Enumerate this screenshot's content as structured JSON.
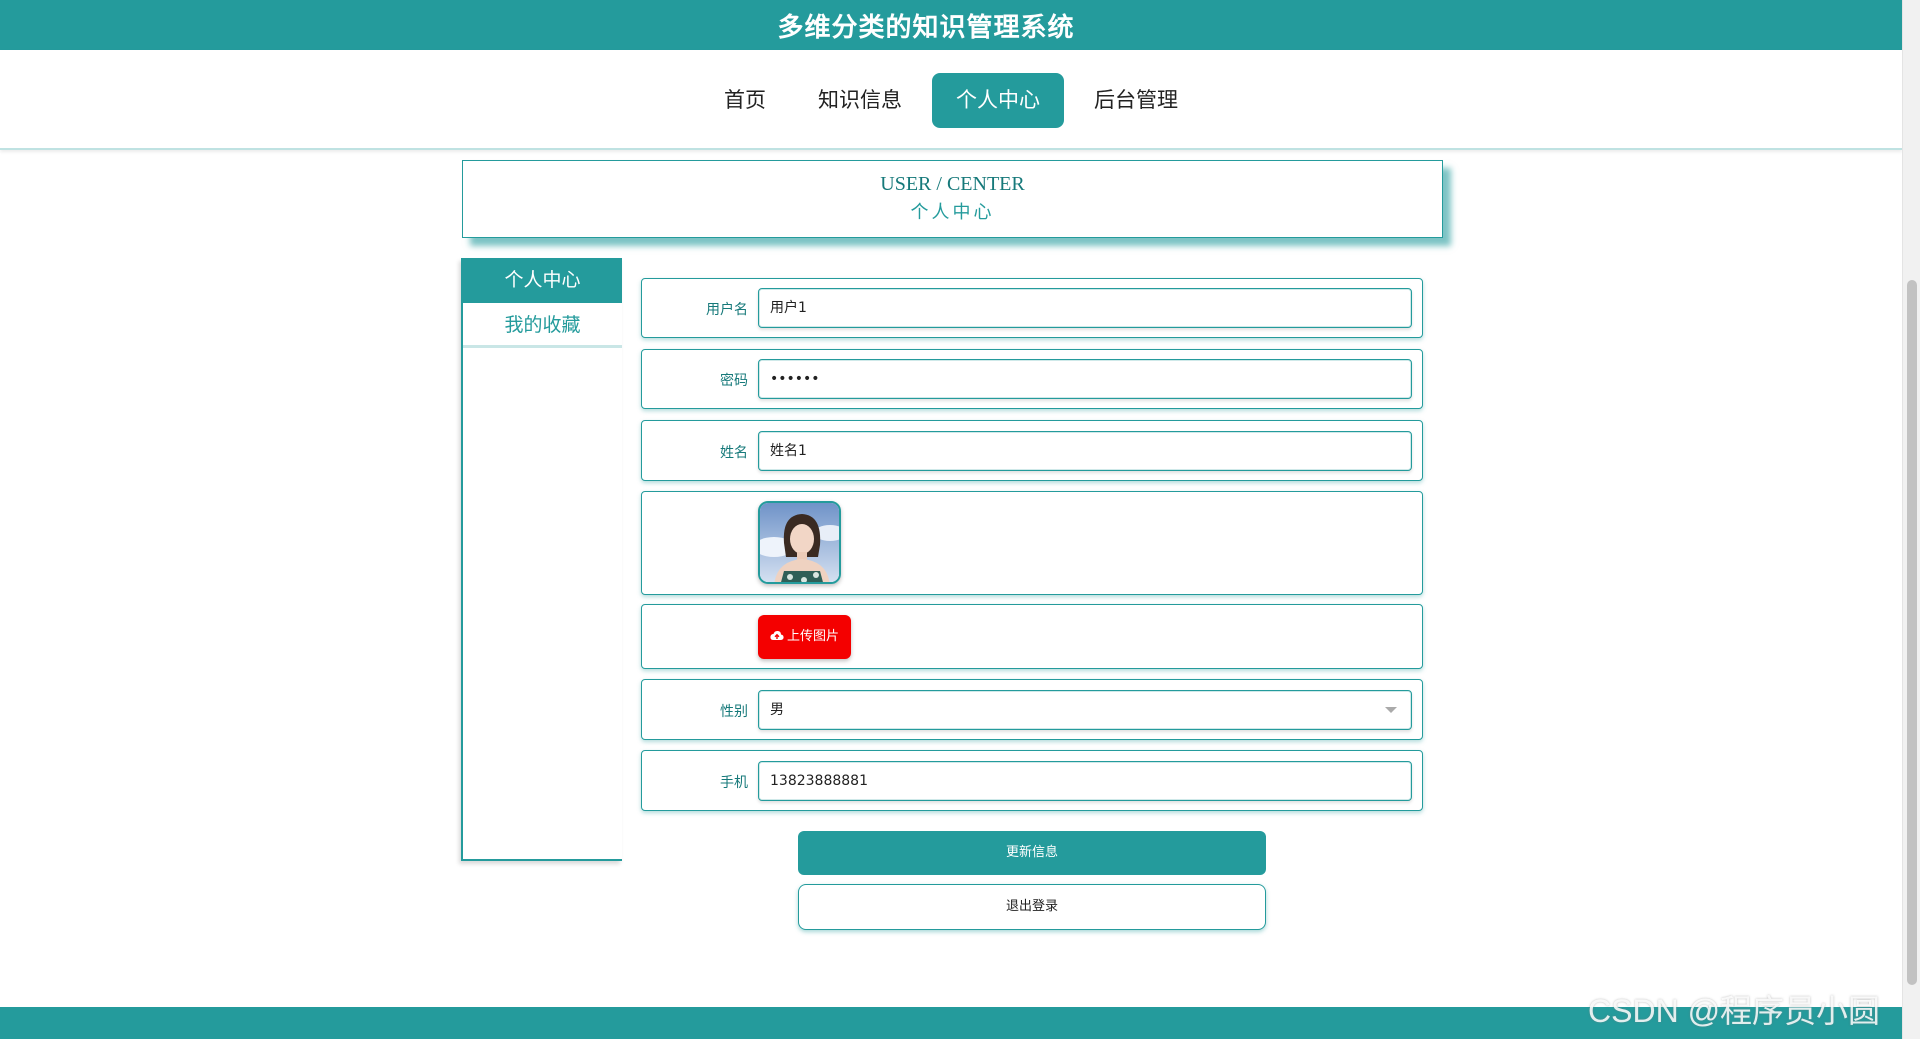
{
  "header": {
    "title": "多维分类的知识管理系统"
  },
  "nav": {
    "items": [
      {
        "label": "首页",
        "active": false
      },
      {
        "label": "知识信息",
        "active": false
      },
      {
        "label": "个人中心",
        "active": true
      },
      {
        "label": "后台管理",
        "active": false
      }
    ]
  },
  "banner": {
    "en": "USER / CENTER",
    "cn": "个人中心"
  },
  "sidebar": {
    "items": [
      {
        "label": "个人中心",
        "active": true
      },
      {
        "label": "我的收藏",
        "active": false
      }
    ]
  },
  "form": {
    "username": {
      "label": "用户名",
      "value": "用户1"
    },
    "password": {
      "label": "密码",
      "value": "••••••"
    },
    "name": {
      "label": "姓名",
      "value": "姓名1"
    },
    "avatar": {
      "icon": "avatar-photo"
    },
    "upload": {
      "label": "上传图片",
      "icon": "cloud-upload-icon"
    },
    "gender": {
      "label": "性别",
      "value": "男"
    },
    "phone": {
      "label": "手机",
      "value": "13823888881"
    }
  },
  "buttons": {
    "update": "更新信息",
    "logout": "退出登录"
  },
  "watermark": "CSDN @程序员小圆",
  "colors": {
    "primary": "#249b9c",
    "danger": "#f40000"
  }
}
